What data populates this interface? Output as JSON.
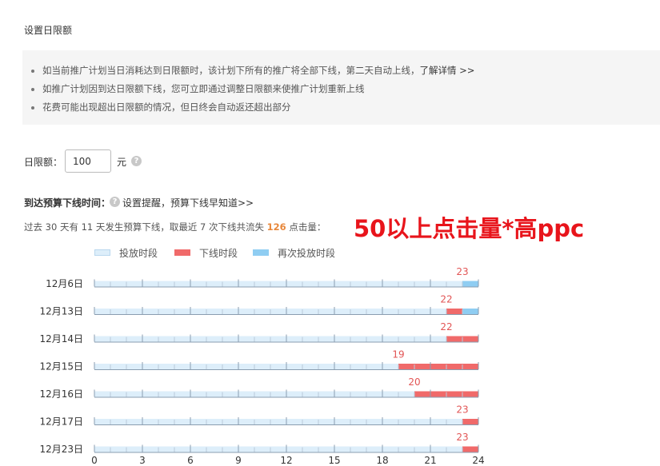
{
  "page_title": "设置日限额",
  "notices": [
    "如当前推广计划当日消耗达到日限额时，该计划下所有的推广将全部下线，第二天自动上线，",
    "如推广计划因到达日限额下线，您可立即通过调整日限额来使推广计划重新上线",
    "花费可能出现超出日限额的情况，但日终会自动返还超出部分"
  ],
  "notice_link": "了解详情 >>",
  "limit": {
    "label": "日限额：",
    "value": "100",
    "unit": "元"
  },
  "budget_section": {
    "title": "到达预算下线时间：",
    "remind_text": "设置提醒，预算下线早知道>>"
  },
  "stats": {
    "prefix": "过去 30 天有 11 天发生预算下线，取最近 7 次下线共流失",
    "lost_clicks": "126",
    "suffix": "点击量："
  },
  "annotation": "50以上点击量*高ppc",
  "colors": {
    "running": "#ddeefa",
    "offline": "#f06a6a",
    "reonline": "#8fcdf2",
    "axis": "#8a9db0",
    "label": "#e25555"
  },
  "chart_data": {
    "type": "bar",
    "orientation": "horizontal-stacked",
    "legend": [
      "投放时段",
      "下线时段",
      "再次投放时段"
    ],
    "legend_placement": "top",
    "xlim": [
      0,
      24
    ],
    "xticks": [
      0,
      3,
      6,
      9,
      12,
      15,
      18,
      21,
      24
    ],
    "categories": [
      "12月6日",
      "12月13日",
      "12月14日",
      "12月15日",
      "12月16日",
      "12月17日",
      "12月23日"
    ],
    "offline_start_hour": [
      23,
      22,
      22,
      19,
      20,
      23,
      23
    ],
    "reonline_start_hour": [
      23,
      23,
      null,
      null,
      null,
      null,
      null
    ],
    "labels": [
      "23",
      "22",
      "22",
      "19",
      "20",
      "23",
      "23"
    ]
  }
}
